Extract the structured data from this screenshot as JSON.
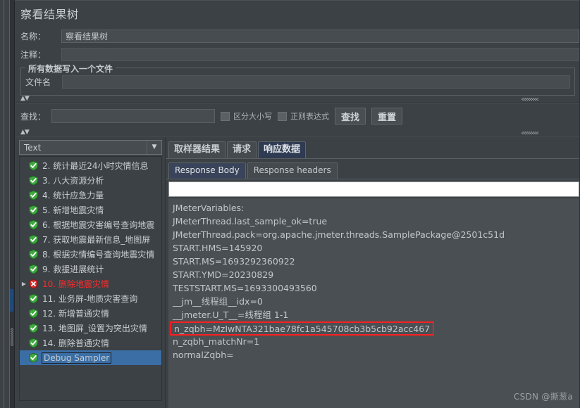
{
  "panel": {
    "title": "察看结果树",
    "name_label": "名称：",
    "name_value": "察看结果树",
    "comment_label": "注释：",
    "comment_value": "",
    "group_title": "所有数据写入一个文件",
    "filename_label": "文件名",
    "filename_value": ""
  },
  "findbar": {
    "label": "查找：",
    "input_value": "",
    "case_sensitive_label": "区分大小写",
    "regex_label": "正则表达式",
    "find_button": "查找",
    "reset_button": "重置"
  },
  "tree": {
    "render_selector": "Text",
    "items": [
      {
        "label": "2. 统计最近24小时灾情信息",
        "status": "ok",
        "expandable": false,
        "selected": false
      },
      {
        "label": "3. 八大资源分析",
        "status": "ok",
        "expandable": false,
        "selected": false
      },
      {
        "label": "4. 统计应急力量",
        "status": "ok",
        "expandable": false,
        "selected": false
      },
      {
        "label": "5. 新增地震灾情",
        "status": "ok",
        "expandable": false,
        "selected": false
      },
      {
        "label": "6. 根据地震灾害编号查询地震",
        "status": "ok",
        "expandable": false,
        "selected": false
      },
      {
        "label": "7. 获取地震最新信息_地图屏",
        "status": "ok",
        "expandable": false,
        "selected": false
      },
      {
        "label": "8. 根据灾情编号查询地震灾情",
        "status": "ok",
        "expandable": false,
        "selected": false
      },
      {
        "label": "9. 救援进展统计",
        "status": "ok",
        "expandable": false,
        "selected": false
      },
      {
        "label": "10. 删除地震灾情",
        "status": "error",
        "expandable": true,
        "selected": false
      },
      {
        "label": "11. 业务屏-地质灾害查询",
        "status": "ok",
        "expandable": false,
        "selected": false
      },
      {
        "label": "12. 新增普通灾情",
        "status": "ok",
        "expandable": false,
        "selected": false
      },
      {
        "label": "13. 地图屏_设置为突出灾情",
        "status": "ok",
        "expandable": false,
        "selected": false
      },
      {
        "label": "14. 删除普通灾情",
        "status": "ok",
        "expandable": false,
        "selected": false
      },
      {
        "label": "Debug Sampler",
        "status": "ok",
        "expandable": false,
        "selected": true
      }
    ]
  },
  "results": {
    "tabs": [
      {
        "label": "取样器结果",
        "active": false
      },
      {
        "label": "请求",
        "active": false
      },
      {
        "label": "响应数据",
        "active": true
      }
    ],
    "subtabs": [
      {
        "label": "Response Body",
        "active": true
      },
      {
        "label": "Response headers",
        "active": false
      }
    ],
    "search_value": "",
    "body_lines": [
      {
        "text": "JMeterVariables:",
        "highlighted": false
      },
      {
        "text": "JMeterThread.last_sample_ok=true",
        "highlighted": false
      },
      {
        "text": "JMeterThread.pack=org.apache.jmeter.threads.SamplePackage@2501c51d",
        "highlighted": false
      },
      {
        "text": "START.HMS=145920",
        "highlighted": false
      },
      {
        "text": "START.MS=1693292360922",
        "highlighted": false
      },
      {
        "text": "START.YMD=20230829",
        "highlighted": false
      },
      {
        "text": "TESTSTART.MS=1693300493560",
        "highlighted": false
      },
      {
        "text": "__jm__线程组__idx=0",
        "highlighted": false
      },
      {
        "text": "__jmeter.U_T__=线程组 1-1",
        "highlighted": false
      },
      {
        "text": "n_zqbh=MzIwNTA321bae78fc1a545708cb3b5cb92acc467",
        "highlighted": true
      },
      {
        "text": "n_zqbh_matchNr=1",
        "highlighted": false
      },
      {
        "text": "normalZqbh=",
        "highlighted": false
      }
    ]
  },
  "watermark": "CSDN @撕葱a",
  "colors": {
    "background": "#3c4145",
    "selection": "#3a6ea5",
    "error_text": "#ff2a2a",
    "highlight_box": "#ff1f1f",
    "ok_icon": "#3fa93f",
    "error_icon": "#d42a2a",
    "active_tab": "#2f3b52"
  }
}
